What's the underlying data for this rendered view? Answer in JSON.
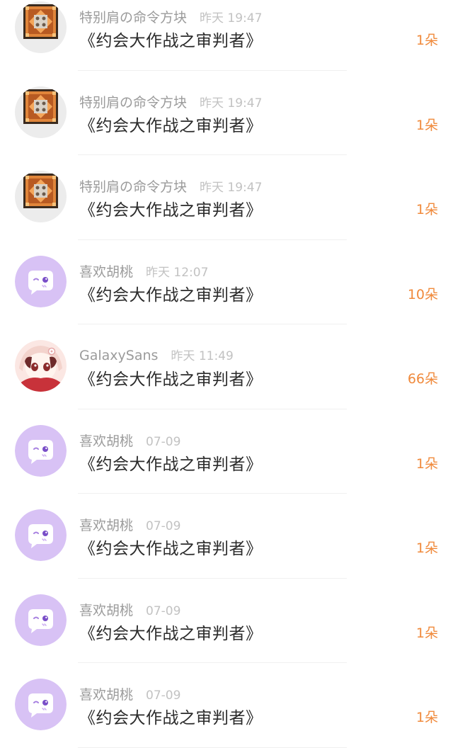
{
  "colors": {
    "username": "#9b9b9b",
    "timestamp": "#c2c2c2",
    "title": "#2b2b2b",
    "flower_count": "#f08a3c",
    "default_avatar_bg": "#d8c2f5"
  },
  "gifts": [
    {
      "user": "特别肩の命令方块",
      "time": "昨天 19:47",
      "title": "《约会大作战之审判者》",
      "count": "1朵",
      "avatar_icon": "command-block-icon"
    },
    {
      "user": "特别肩の命令方块",
      "time": "昨天 19:47",
      "title": "《约会大作战之审判者》",
      "count": "1朵",
      "avatar_icon": "command-block-icon"
    },
    {
      "user": "特别肩の命令方块",
      "time": "昨天 19:47",
      "title": "《约会大作战之审判者》",
      "count": "1朵",
      "avatar_icon": "command-block-icon"
    },
    {
      "user": "喜欢胡桃",
      "time": "昨天 12:07",
      "title": "《约会大作战之审判者》",
      "count": "10朵",
      "avatar_icon": "default-chat-bubble-icon"
    },
    {
      "user": "GalaxySans",
      "time": "昨天 11:49",
      "title": "《约会大作战之审判者》",
      "count": "66朵",
      "avatar_icon": "anime-character-icon"
    },
    {
      "user": "喜欢胡桃",
      "time": "07-09",
      "title": "《约会大作战之审判者》",
      "count": "1朵",
      "avatar_icon": "default-chat-bubble-icon"
    },
    {
      "user": "喜欢胡桃",
      "time": "07-09",
      "title": "《约会大作战之审判者》",
      "count": "1朵",
      "avatar_icon": "default-chat-bubble-icon"
    },
    {
      "user": "喜欢胡桃",
      "time": "07-09",
      "title": "《约会大作战之审判者》",
      "count": "1朵",
      "avatar_icon": "default-chat-bubble-icon"
    },
    {
      "user": "喜欢胡桃",
      "time": "07-09",
      "title": "《约会大作战之审判者》",
      "count": "1朵",
      "avatar_icon": "default-chat-bubble-icon"
    }
  ]
}
